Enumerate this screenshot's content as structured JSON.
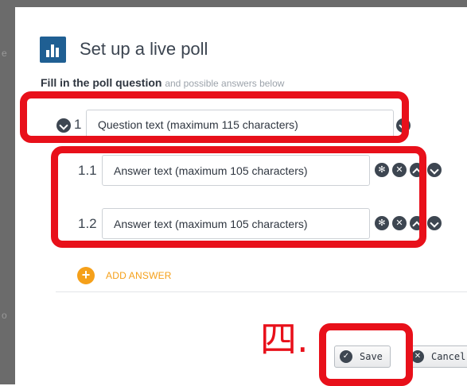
{
  "dialog": {
    "title": "Set up a live poll",
    "subtitle_bold": "Fill in the poll question",
    "subtitle_rest": "and possible answers below"
  },
  "question": {
    "number": "1",
    "text": "Question text (maximum 115 characters)"
  },
  "answers": [
    {
      "number": "1.1",
      "text": "Answer text (maximum 105 characters)"
    },
    {
      "number": "1.2",
      "text": "Answer text (maximum 105 characters)"
    }
  ],
  "add_answer": {
    "label": "ADD ANSWER",
    "icon": "plus-icon"
  },
  "buttons": {
    "save_label": "Save",
    "cancel_label": "Cancel"
  },
  "annotation": {
    "marker_text": "四."
  },
  "colors": {
    "annotation_red": "#e8101a",
    "accent_orange": "#f5a01a",
    "brand_blue": "#1f5f93",
    "icon_dark": "#3d4651"
  }
}
